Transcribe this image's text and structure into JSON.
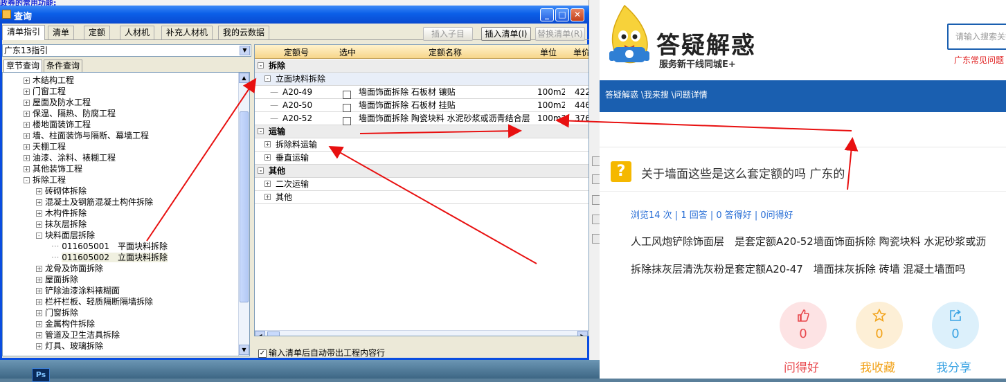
{
  "background": {
    "dialog_strip_title": "政券的常用功能:",
    "ps_icon": "Ps"
  },
  "dialog": {
    "title": "查询",
    "window_buttons": [
      "_",
      "□",
      "✕"
    ],
    "tabs": [
      "清单指引",
      "清单",
      "定额",
      "人材机",
      "补充人材机",
      "我的云数据"
    ],
    "buttons": {
      "insert_child": "插入子目",
      "insert_list": "插入清单(I)",
      "replace_list": "替换清单(R)"
    },
    "guide_select": "广东13指引",
    "sub_tabs": [
      "章节查询",
      "条件查询"
    ],
    "tree": [
      {
        "label": "木结构工程",
        "lvl": 1,
        "pm": "+"
      },
      {
        "label": "门窗工程",
        "lvl": 1,
        "pm": "+"
      },
      {
        "label": "屋面及防水工程",
        "lvl": 1,
        "pm": "+"
      },
      {
        "label": "保温、隔热、防腐工程",
        "lvl": 1,
        "pm": "+"
      },
      {
        "label": "楼地面装饰工程",
        "lvl": 1,
        "pm": "+"
      },
      {
        "label": "墙、柱面装饰与隔断、幕墙工程",
        "lvl": 1,
        "pm": "+"
      },
      {
        "label": "天棚工程",
        "lvl": 1,
        "pm": "+"
      },
      {
        "label": "油漆、涂料、裱糊工程",
        "lvl": 1,
        "pm": "+"
      },
      {
        "label": "其他装饰工程",
        "lvl": 1,
        "pm": "+"
      },
      {
        "label": "拆除工程",
        "lvl": 1,
        "pm": "-"
      },
      {
        "label": "砖砌体拆除",
        "lvl": 2,
        "pm": "+"
      },
      {
        "label": "混凝土及钢筋混凝土构件拆除",
        "lvl": 2,
        "pm": "+"
      },
      {
        "label": "木构件拆除",
        "lvl": 2,
        "pm": "+"
      },
      {
        "label": "抹灰层拆除",
        "lvl": 2,
        "pm": "+"
      },
      {
        "label": "块料面层拆除",
        "lvl": 2,
        "pm": "-"
      },
      {
        "label": "011605001　平面块料拆除",
        "lvl": 3,
        "pm": ""
      },
      {
        "label": "011605002　立面块料拆除",
        "lvl": 3,
        "pm": "",
        "sel": true
      },
      {
        "label": "龙骨及饰面拆除",
        "lvl": 2,
        "pm": "+"
      },
      {
        "label": "屋面拆除",
        "lvl": 2,
        "pm": "+"
      },
      {
        "label": "铲除油漆涂料裱糊面",
        "lvl": 2,
        "pm": "+"
      },
      {
        "label": "栏杆栏板、轻质隔断隔墙拆除",
        "lvl": 2,
        "pm": "+"
      },
      {
        "label": "门窗拆除",
        "lvl": 2,
        "pm": "+"
      },
      {
        "label": "金属构件拆除",
        "lvl": 2,
        "pm": "+"
      },
      {
        "label": "管道及卫生洁具拆除",
        "lvl": 2,
        "pm": "+"
      },
      {
        "label": "灯具、玻璃拆除",
        "lvl": 2,
        "pm": "+"
      }
    ],
    "grid": {
      "headers": [
        "定额号",
        "选中",
        "定额名称",
        "单位",
        "单价"
      ],
      "rows": [
        {
          "kind": "group",
          "pm": "-",
          "name": "拆除"
        },
        {
          "kind": "sub",
          "pm": "-",
          "name": "立面块料拆除"
        },
        {
          "kind": "item",
          "code": "A20-49",
          "name": "墙面饰面拆除 石板材 镶贴",
          "unit": "100m2",
          "price": "422"
        },
        {
          "kind": "item",
          "code": "A20-50",
          "name": "墙面饰面拆除 石板材 挂贴",
          "unit": "100m2",
          "price": "446"
        },
        {
          "kind": "item",
          "code": "A20-52",
          "name": "墙面饰面拆除 陶瓷块料 水泥砂浆或沥青结合层",
          "unit": "100m2",
          "price": "376"
        },
        {
          "kind": "group",
          "pm": "-",
          "name": "运输"
        },
        {
          "kind": "sub2",
          "pm": "+",
          "name": "拆除料运输"
        },
        {
          "kind": "sub2",
          "pm": "+",
          "name": "垂直运输"
        },
        {
          "kind": "group",
          "pm": "-",
          "name": "其他"
        },
        {
          "kind": "sub2",
          "pm": "+",
          "name": "二次运输"
        },
        {
          "kind": "sub2",
          "pm": "+",
          "name": "其他"
        }
      ]
    },
    "auto_checkbox": "输入清单后自动带出工程内容行"
  },
  "web": {
    "logo_title": "答疑解惑",
    "logo_sub": "服务新干线同城E+",
    "search_placeholder": "请输入搜索关键",
    "hot_link": "广东常见问题",
    "breadcrumb": "答疑解惑 \\我来搜 \\问题详情",
    "question_title": "关于墙面这些是这么套定额的吗 广东的",
    "stats": "浏览14 次 | 1 回答 | 0 答得好 | 0问得好",
    "body_lines": [
      "人工风炮铲除饰面层　是套定额A20-52墙面饰面拆除 陶瓷块料 水泥砂浆或沥",
      "拆除抹灰层清洗灰粉是套定额A20-47　墙面抹灰拆除 砖墙 混凝土墙面吗"
    ],
    "actions": [
      {
        "label": "问得好",
        "count": "0",
        "color": "#e8484d",
        "bg": "#fde3e4"
      },
      {
        "label": "我收藏",
        "count": "0",
        "color": "#f2a31a",
        "bg": "#fdefd6"
      },
      {
        "label": "我分享",
        "count": "0",
        "color": "#3aa3e3",
        "bg": "#dcf0fb"
      }
    ]
  }
}
